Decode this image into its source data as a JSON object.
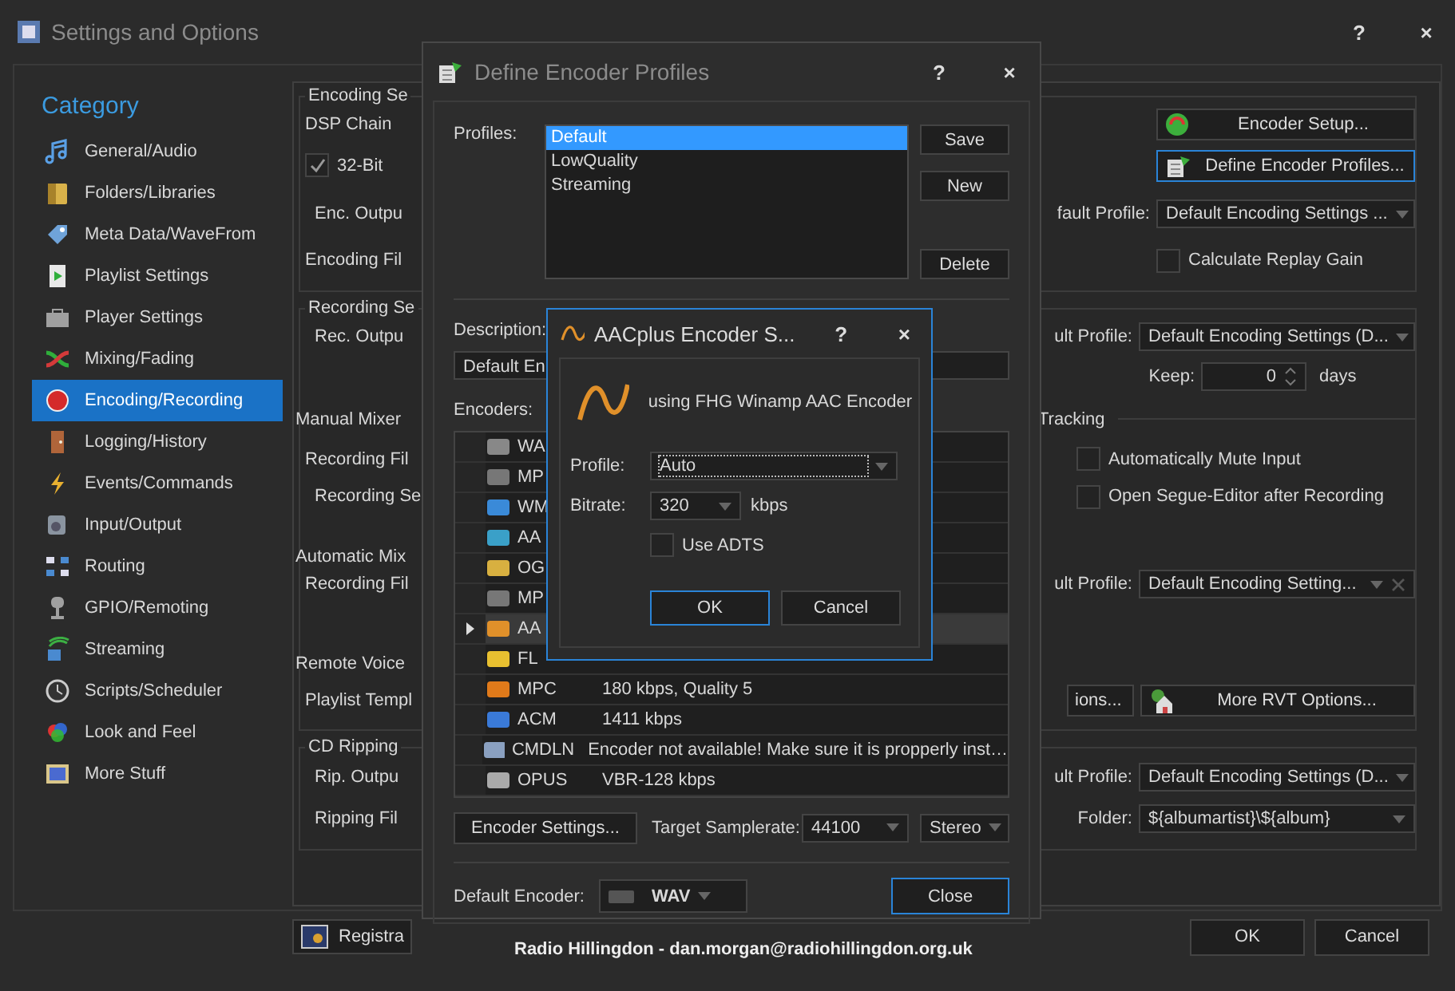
{
  "main_window": {
    "title": "Settings and Options",
    "help": "?",
    "close": "×"
  },
  "sidebar": {
    "heading": "Category",
    "items": [
      {
        "label": "General/Audio",
        "selected": false
      },
      {
        "label": "Folders/Libraries",
        "selected": false
      },
      {
        "label": "Meta Data/WaveFrom",
        "selected": false
      },
      {
        "label": "Playlist Settings",
        "selected": false
      },
      {
        "label": "Player Settings",
        "selected": false
      },
      {
        "label": "Mixing/Fading",
        "selected": false
      },
      {
        "label": "Encoding/Recording",
        "selected": true
      },
      {
        "label": "Logging/History",
        "selected": false
      },
      {
        "label": "Events/Commands",
        "selected": false
      },
      {
        "label": "Input/Output",
        "selected": false
      },
      {
        "label": "Routing",
        "selected": false
      },
      {
        "label": "GPIO/Remoting",
        "selected": false
      },
      {
        "label": "Streaming",
        "selected": false
      },
      {
        "label": "Scripts/Scheduler",
        "selected": false
      },
      {
        "label": "Look and Feel",
        "selected": false
      },
      {
        "label": "More Stuff",
        "selected": false
      }
    ]
  },
  "encoding_group": {
    "legend": "Encoding Se",
    "dsp_legend": "DSP Chain",
    "bit32": {
      "label": "32-Bit",
      "checked": true
    },
    "enc_output_label": "Enc. Outpu",
    "encoding_file_label": "Encoding Fil",
    "encoder_setup": {
      "label": "Encoder Setup...",
      "focused": false
    },
    "define_profiles": {
      "label": "Define Encoder Profiles...",
      "focused": true
    },
    "profile_label": "fault Profile:",
    "profile_value": "Default Encoding Settings ...",
    "replay_gain": {
      "label": "Calculate Replay Gain",
      "checked": false
    }
  },
  "recording_group": {
    "legend": "Recording Se",
    "rec_output_label": "Rec. Outpu",
    "profile_label": "ult Profile:",
    "profile_value": "Default Encoding Settings (D...",
    "keep_label": "Keep:",
    "keep_value": "0",
    "keep_unit": "days",
    "manual_mixer_label": "Manual Mixer",
    "tracking_legend": "Tracking",
    "recording_file_label": "Recording Fil",
    "mute_input": {
      "label": "Automatically Mute Input",
      "checked": false
    },
    "recording_se_label": "Recording Se",
    "segue_editor": {
      "label": "Open Segue-Editor after Recording",
      "checked": false
    },
    "automatic_mix_label": "Automatic Mix",
    "auto_recording_file_label": "Recording Fil",
    "auto_profile_label": "ult Profile:",
    "auto_profile_value": "Default Encoding Setting...",
    "remote_voice_label": "Remote Voice",
    "playlist_template_label": "Playlist Templ",
    "options_button": "ions...",
    "rvt_button": "More RVT Options..."
  },
  "cd_ripping_group": {
    "legend": "CD Ripping",
    "rip_output_label": "Rip. Outpu",
    "ripping_file_label": "Ripping Fil",
    "profile_label": "ult Profile:",
    "profile_value": "Default Encoding Settings (D...",
    "folder_label": "Folder:",
    "folder_value": "${albumartist}\\${album}"
  },
  "footer": {
    "registration": "Registra",
    "station": "Radio Hillingdon - dan.morgan@radiohillingdon.org.uk",
    "ok": "OK",
    "cancel": "Cancel"
  },
  "profiles_dialog": {
    "title": "Define Encoder Profiles",
    "help": "?",
    "close": "×",
    "profiles_label": "Profiles:",
    "profiles": [
      {
        "label": "Default",
        "selected": true
      },
      {
        "label": "LowQuality",
        "selected": false
      },
      {
        "label": "Streaming",
        "selected": false
      }
    ],
    "save": "Save",
    "new": "New",
    "delete": "Delete",
    "description_label": "Description:",
    "description_value": "Default En",
    "encoders_label": "Encoders:",
    "encoders": [
      {
        "name": "WA",
        "selected": false
      },
      {
        "name": "MP",
        "selected": false
      },
      {
        "name": "WM",
        "selected": false
      },
      {
        "name": "AA",
        "selected": false
      },
      {
        "name": "OG",
        "selected": false
      },
      {
        "name": "MP",
        "selected": false
      },
      {
        "name": "AA",
        "selected": true
      },
      {
        "name": "FL",
        "selected": false
      },
      {
        "name": "MPC",
        "details": "180 kbps, Quality 5",
        "selected": false
      },
      {
        "name": "ACM",
        "details": "1411 kbps",
        "selected": false
      },
      {
        "name": "CMDLN",
        "details": "Encoder not available! Make sure it is propperly inst…",
        "selected": false
      },
      {
        "name": "OPUS",
        "details": "VBR-128 kbps",
        "selected": false
      }
    ],
    "encoder_settings": "Encoder Settings...",
    "samplerate_label": "Target Samplerate:",
    "samplerate": "44100",
    "channels": "Stereo",
    "default_encoder_label": "Default Encoder:",
    "default_encoder": "WAV",
    "close_button": {
      "label": "Close",
      "focused": true
    }
  },
  "aac_dialog": {
    "title": "AACplus Encoder S...",
    "help": "?",
    "close": "×",
    "info": "using FHG Winamp AAC Encoder",
    "profile_label": "Profile:",
    "profile_value": "Auto",
    "bitrate_label": "Bitrate:",
    "bitrate_value": "320",
    "bitrate_unit": "kbps",
    "use_adts": {
      "label": "Use ADTS",
      "checked": false
    },
    "ok": {
      "label": "OK",
      "focused": true
    },
    "cancel": {
      "label": "Cancel",
      "focused": false
    }
  }
}
